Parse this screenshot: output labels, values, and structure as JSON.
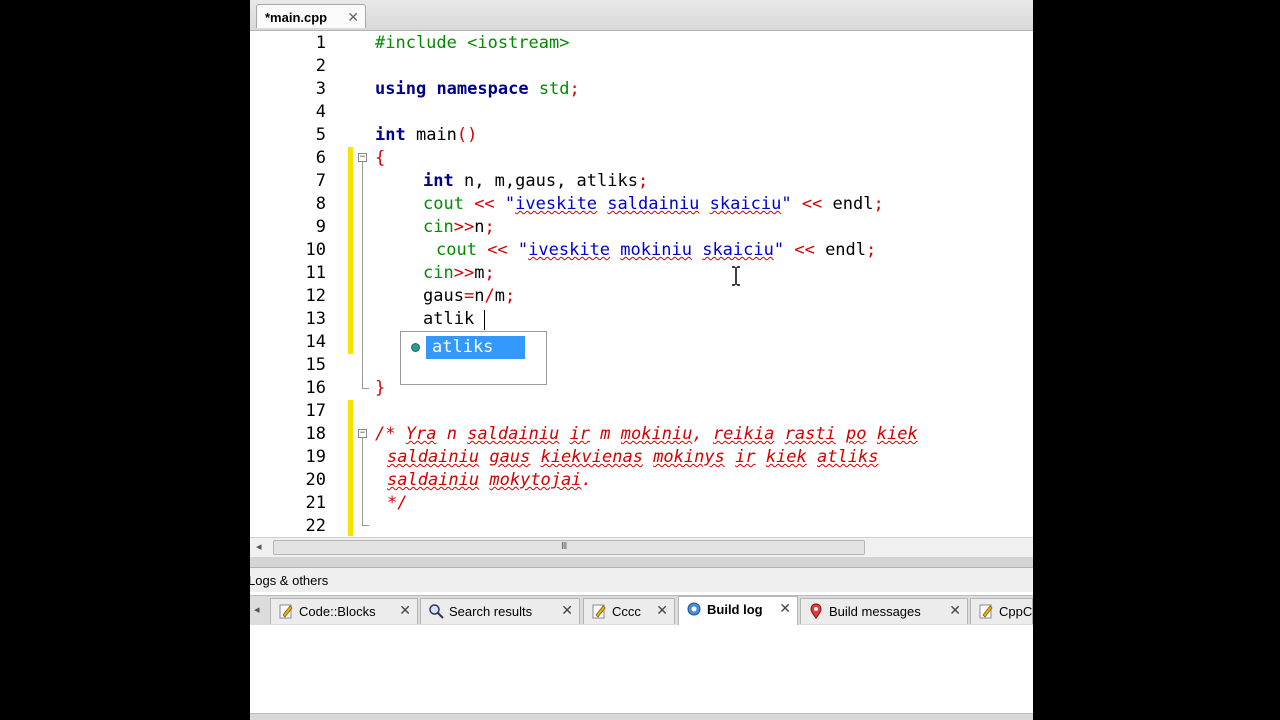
{
  "editor_tab": {
    "label": "*main.cpp",
    "close": "✕"
  },
  "line_numbers": [
    "1",
    "2",
    "3",
    "4",
    "5",
    "6",
    "7",
    "8",
    "9",
    "10",
    "11",
    "12",
    "13",
    "14",
    "15",
    "16",
    "17",
    "18",
    "19",
    "20",
    "21",
    "22"
  ],
  "code": {
    "l1": {
      "kw": "#include",
      "rest": " <iostream>"
    },
    "l3": {
      "kw1": "using",
      "kw2": "namespace",
      "kw3": "std",
      "semi": ";"
    },
    "l5": {
      "kw": "int",
      "rest": " main",
      "paren": "()"
    },
    "l6": {
      "brace": "{"
    },
    "l7": {
      "kw": "int",
      "rest": " n, m,gaus, atliks",
      "semi": ";"
    },
    "l8": {
      "kw": "cout",
      "op1": " << ",
      "q1": "\"",
      "w1": "iveskite",
      "sp1": " ",
      "w2": "saldainiu",
      "sp2": " ",
      "w3": "skaiciu",
      "q2": "\"",
      "op2": " << ",
      "rest": "endl",
      "semi": ";"
    },
    "l9": {
      "kw": "cin",
      "op": ">>",
      "rest": "n",
      "semi": ";"
    },
    "l10": {
      "kw": "cout",
      "op1": " << ",
      "q1": "\"",
      "w1": "iveskite",
      "sp1": " ",
      "w2": "mokiniu",
      "sp2": " ",
      "w3": "skaiciu",
      "q2": "\"",
      "op2": " << ",
      "rest": "endl",
      "semi": ";"
    },
    "l11": {
      "kw": "cin",
      "op": ">>",
      "rest": "m",
      "semi": ";"
    },
    "l12": {
      "a": "gaus",
      "eq": "=",
      "b": "n",
      "div": "/",
      "c": "m",
      "semi": ";"
    },
    "l13": {
      "text": "atlik"
    },
    "l16": {
      "brace": "}"
    },
    "l18": {
      "start": "/* ",
      "w1": "Yra",
      "s1": " ",
      "w2": "n",
      "s2": " ",
      "w3": "saldainiu",
      "s3": " ",
      "w4": "ir",
      "s4": " ",
      "w5": "m",
      "s5": " ",
      "w6": "mokiniu",
      "s6": ", ",
      "w7": "reikia",
      "s7": " ",
      "w8": "rasti",
      "s8": " ",
      "w9": "po",
      "s9": " ",
      "w10": "kiek"
    },
    "l19": {
      "w1": "saldainiu",
      "s1": " ",
      "w2": "gaus",
      "s2": " ",
      "w3": "kiekvienas",
      "s3": " ",
      "w4": "mokinys",
      "s4": " ",
      "w5": "ir",
      "s5": " ",
      "w6": "kiek",
      "s6": " ",
      "w7": "atliks"
    },
    "l20": {
      "w1": "saldainiu",
      "s1": " ",
      "w2": "mokytojai",
      "end": "."
    },
    "l21": {
      "end": "*/"
    }
  },
  "autocomplete": {
    "items": [
      "atliks"
    ]
  },
  "scrollbar": {
    "grip": "III"
  },
  "logs_panel": {
    "title": "Logs & others",
    "tabs": [
      {
        "label": "Code::Blocks",
        "close": "✕"
      },
      {
        "label": "Search results",
        "close": "✕"
      },
      {
        "label": "Cccc",
        "close": "✕"
      },
      {
        "label": "Build log",
        "close": "✕"
      },
      {
        "label": "Build messages",
        "close": "✕"
      },
      {
        "label": "CppC"
      }
    ],
    "active_tab": "Build log"
  },
  "colors": {
    "keyword": "#00008b",
    "preprocessor": "#008b00",
    "operator": "#d40000",
    "string": "#0000d0",
    "comment": "#d40000",
    "selection": "#3399ff",
    "change_bar": "#f5e400"
  }
}
